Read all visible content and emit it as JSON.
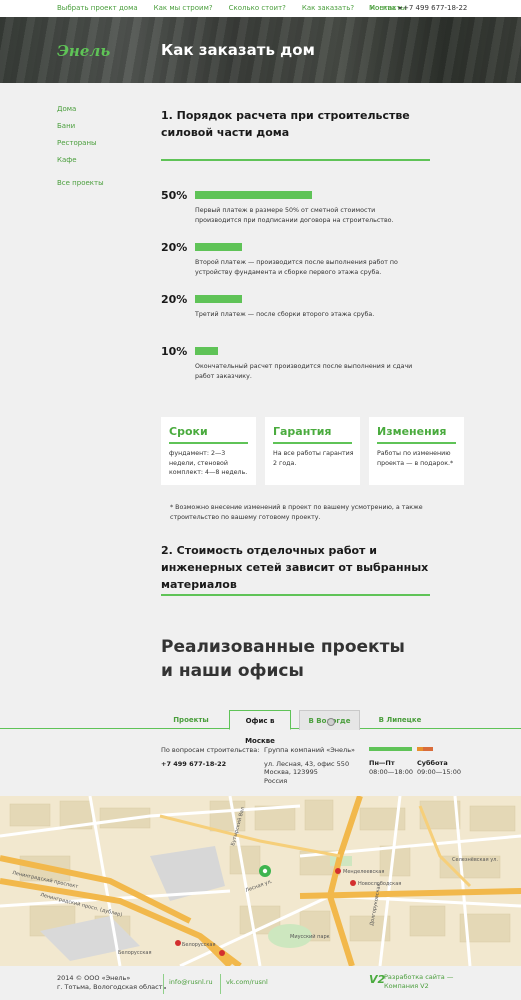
{
  "nav": {
    "items": [
      "Выбрать проект дома",
      "Как мы строим?",
      "Сколько стоит?",
      "Как заказать?",
      "Контакты"
    ],
    "city": "Москва",
    "phone": "+7 499 677-18-22"
  },
  "hero": {
    "logo": "Энель",
    "title": "Как заказать дом"
  },
  "sidebar": {
    "items": [
      "Дома",
      "Бани",
      "Рестораны",
      "Кафе"
    ],
    "all": "Все проекты"
  },
  "section1": {
    "title": "1. Порядок расчета при строительстве силовой части дома"
  },
  "payments": [
    {
      "percent": "50%",
      "share": 50,
      "text": "Первый платеж в размере 50% от сметной стоимости производится при подписании договора на строительство."
    },
    {
      "percent": "20%",
      "share": 20,
      "text": "Второй платеж — производится после выполнения работ по устройству фундамента и сборке первого этажа сруба."
    },
    {
      "percent": "20%",
      "share": 20,
      "text": "Третий платеж — после сборки второго этажа сруба."
    },
    {
      "percent": "10%",
      "share": 10,
      "text": "Окончательный расчет производится после выполнения и сдачи работ заказчику."
    }
  ],
  "cards": [
    {
      "title": "Сроки",
      "text": "фундамент: 2—3 недели, стеновой комплект: 4—8 недель."
    },
    {
      "title": "Гарантия",
      "text": "На все работы гарантия 2 года."
    },
    {
      "title": "Изменения",
      "text": "Работы по изменению проекта — в подарок.*"
    }
  ],
  "note": "* Возможно внесение изменений в проект по вашему усмотрению, а также строительство по вашему готовому проекту.",
  "section2": {
    "title": "2. Стоимость отделочных работ и инженерных сетей зависит от выбранных материалов"
  },
  "projects": {
    "title_line1": "Реализованные проекты",
    "title_line2": "и наши офисы"
  },
  "tabs": [
    "Проекты",
    "Офис в Москве",
    "В Вологде",
    "В Липецке"
  ],
  "office": {
    "label": "По вопросам строительства:",
    "phone": "+7 499 677-18-22",
    "company": "Группа компаний «Энель»",
    "address": [
      "ул. Лесная, 43, офис 550",
      "Москва, 123995",
      "Россия"
    ],
    "weekday_label": "Пн—Пт",
    "weekday_hours": "08:00—18:00",
    "saturday_label": "Суббота",
    "saturday_hours": "09:00—15:00"
  },
  "map": {
    "labels": [
      "Ленинградский проспект",
      "Ленинградский просп. (дублер)",
      "Белорусская",
      "Менделеевская",
      "Новослободская",
      "Долгоруковская",
      "Селезнёвская ул.",
      "Лесная ул.",
      "Бутырский Вал",
      "Миусский парк",
      "Белорусская"
    ]
  },
  "footer": {
    "copy_line1": "2014 © ООО «Энель»",
    "copy_line2": "г. Тотьма, Вологодская область",
    "email": "info@rusnl.ru",
    "vk": "vk.com/rusnl",
    "dev_logo": "V2",
    "dev_line1": "Разработка сайта —",
    "dev_line2": "Компания V2"
  },
  "colors": {
    "accent": "#5fc357",
    "link": "#4a9e3c",
    "background": "#f0f0f0"
  }
}
